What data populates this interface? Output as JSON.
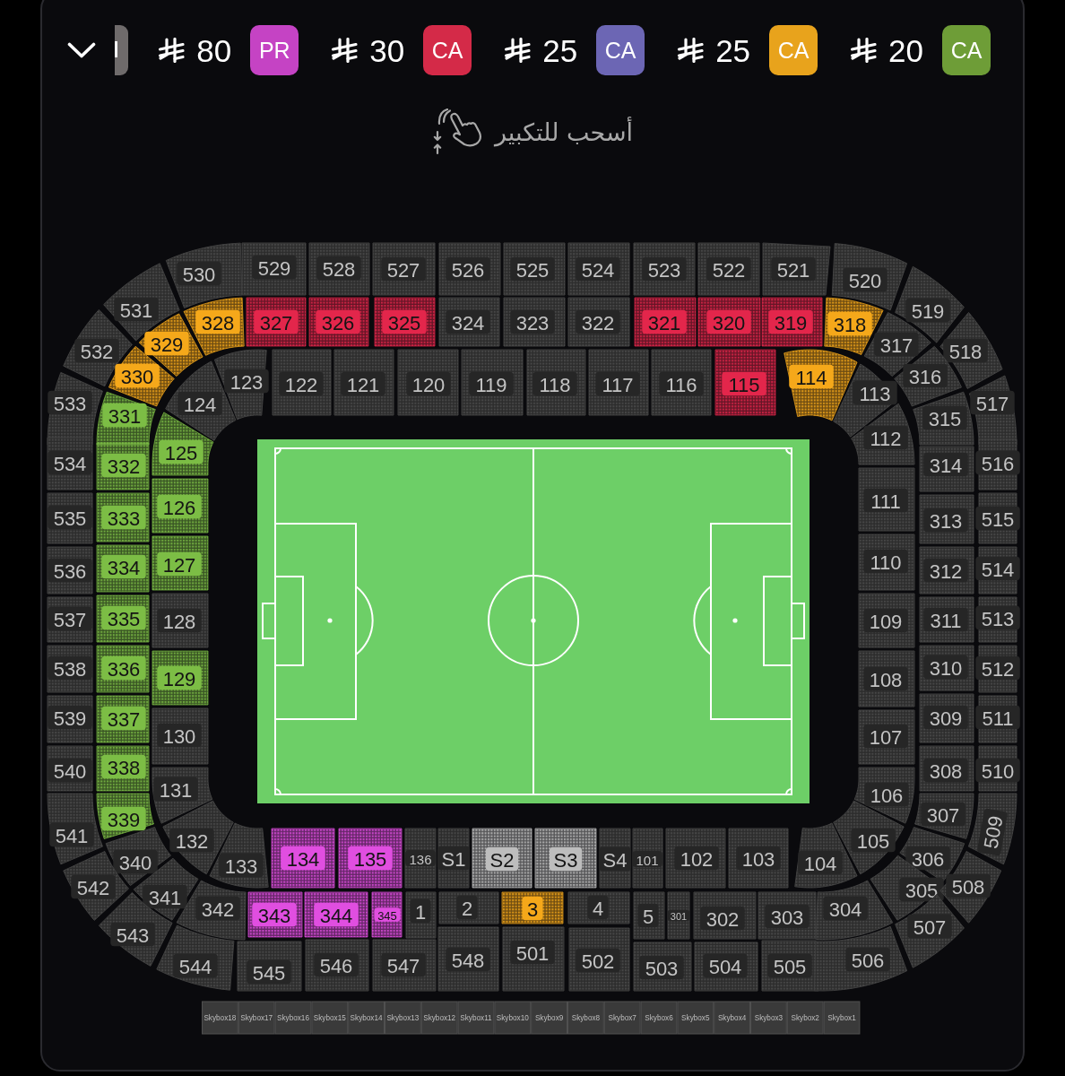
{
  "top_bar": {
    "price_tags": [
      {
        "kind": "clipped",
        "color": "#6f6b6b"
      },
      {
        "kind": "price",
        "price": "80",
        "badge": "PR",
        "color": "#c543c4"
      },
      {
        "kind": "price",
        "price": "30",
        "badge": "CA",
        "color": "#d42a48"
      },
      {
        "kind": "price",
        "price": "25",
        "badge": "CA",
        "color": "#6c66b4"
      },
      {
        "kind": "price",
        "price": "25",
        "badge": "CA",
        "color": "#e8a31c"
      },
      {
        "kind": "price",
        "price": "20",
        "badge": "CA",
        "color": "#6e9d37"
      }
    ]
  },
  "hint": {
    "text": "أسحب للتكبير"
  },
  "seat_map": {
    "sections": [
      {
        "label": "530",
        "available": false
      },
      {
        "label": "529",
        "available": false
      },
      {
        "label": "528",
        "available": false
      },
      {
        "label": "527",
        "available": false
      },
      {
        "label": "526",
        "available": false
      },
      {
        "label": "525",
        "available": false
      },
      {
        "label": "524",
        "available": false
      },
      {
        "label": "523",
        "available": false
      },
      {
        "label": "522",
        "available": false
      },
      {
        "label": "521",
        "available": false
      },
      {
        "label": "520",
        "available": false
      },
      {
        "label": "531",
        "available": false
      },
      {
        "label": "328",
        "available": true,
        "color": "#f5a81a"
      },
      {
        "label": "327",
        "available": true,
        "color": "#e3264b"
      },
      {
        "label": "326",
        "available": true,
        "color": "#e3264b"
      },
      {
        "label": "325",
        "available": true,
        "color": "#e3264b"
      },
      {
        "label": "324",
        "available": false
      },
      {
        "label": "323",
        "available": false
      },
      {
        "label": "322",
        "available": false
      },
      {
        "label": "321",
        "available": true,
        "color": "#e3264b"
      },
      {
        "label": "320",
        "available": true,
        "color": "#e3264b"
      },
      {
        "label": "319",
        "available": true,
        "color": "#e3264b"
      },
      {
        "label": "318",
        "available": true,
        "color": "#f5a81a"
      },
      {
        "label": "519",
        "available": false
      },
      {
        "label": "532",
        "available": false
      },
      {
        "label": "329",
        "available": true,
        "color": "#f5a81a"
      },
      {
        "label": "330",
        "available": true,
        "color": "#f5a81a"
      },
      {
        "label": "123",
        "available": false
      },
      {
        "label": "122",
        "available": false
      },
      {
        "label": "121",
        "available": false
      },
      {
        "label": "120",
        "available": false
      },
      {
        "label": "119",
        "available": false
      },
      {
        "label": "118",
        "available": false
      },
      {
        "label": "117",
        "available": false
      },
      {
        "label": "116",
        "available": false
      },
      {
        "label": "115",
        "available": true,
        "color": "#e3264b"
      },
      {
        "label": "114",
        "available": true,
        "color": "#f5a81a"
      },
      {
        "label": "317",
        "available": false
      },
      {
        "label": "518",
        "available": false
      },
      {
        "label": "316",
        "available": false
      },
      {
        "label": "113",
        "available": false
      },
      {
        "label": "533",
        "available": false
      },
      {
        "label": "331",
        "available": true,
        "color": "#7cbd45"
      },
      {
        "label": "124",
        "available": false
      },
      {
        "label": "315",
        "available": false
      },
      {
        "label": "517",
        "available": false
      },
      {
        "label": "534",
        "available": false
      },
      {
        "label": "332",
        "available": true,
        "color": "#7cbd45"
      },
      {
        "label": "125",
        "available": true,
        "color": "#7cbd45"
      },
      {
        "label": "112",
        "available": false
      },
      {
        "label": "314",
        "available": false
      },
      {
        "label": "516",
        "available": false
      },
      {
        "label": "535",
        "available": false
      },
      {
        "label": "333",
        "available": true,
        "color": "#7cbd45"
      },
      {
        "label": "126",
        "available": true,
        "color": "#7cbd45"
      },
      {
        "label": "111",
        "available": false
      },
      {
        "label": "313",
        "available": false
      },
      {
        "label": "515",
        "available": false
      },
      {
        "label": "536",
        "available": false
      },
      {
        "label": "334",
        "available": true,
        "color": "#7cbd45"
      },
      {
        "label": "127",
        "available": true,
        "color": "#7cbd45"
      },
      {
        "label": "110",
        "available": false
      },
      {
        "label": "312",
        "available": false
      },
      {
        "label": "514",
        "available": false
      },
      {
        "label": "537",
        "available": false
      },
      {
        "label": "335",
        "available": true,
        "color": "#7cbd45"
      },
      {
        "label": "128",
        "available": false
      },
      {
        "label": "109",
        "available": false
      },
      {
        "label": "311",
        "available": false
      },
      {
        "label": "513",
        "available": false
      },
      {
        "label": "538",
        "available": false
      },
      {
        "label": "336",
        "available": true,
        "color": "#7cbd45"
      },
      {
        "label": "129",
        "available": true,
        "color": "#7cbd45"
      },
      {
        "label": "108",
        "available": false
      },
      {
        "label": "310",
        "available": false
      },
      {
        "label": "512",
        "available": false
      },
      {
        "label": "539",
        "available": false
      },
      {
        "label": "337",
        "available": true,
        "color": "#7cbd45"
      },
      {
        "label": "130",
        "available": false
      },
      {
        "label": "107",
        "available": false
      },
      {
        "label": "309",
        "available": false
      },
      {
        "label": "511",
        "available": false
      },
      {
        "label": "540",
        "available": false
      },
      {
        "label": "338",
        "available": true,
        "color": "#7cbd45"
      },
      {
        "label": "131",
        "available": false
      },
      {
        "label": "106",
        "available": false
      },
      {
        "label": "308",
        "available": false
      },
      {
        "label": "510",
        "available": false
      },
      {
        "label": "541",
        "available": false
      },
      {
        "label": "339",
        "available": true,
        "color": "#7cbd45"
      },
      {
        "label": "132",
        "available": false
      },
      {
        "label": "105",
        "available": false
      },
      {
        "label": "307",
        "available": false
      },
      {
        "label": "509",
        "available": false
      },
      {
        "label": "340",
        "available": false
      },
      {
        "label": "133",
        "available": false
      },
      {
        "label": "134",
        "available": true,
        "color": "#e04ee0"
      },
      {
        "label": "135",
        "available": true,
        "color": "#e04ee0"
      },
      {
        "label": "136",
        "available": false
      },
      {
        "label": "S1",
        "available": false
      },
      {
        "label": "S2",
        "available": true,
        "color": "#bdbdbd"
      },
      {
        "label": "S3",
        "available": true,
        "color": "#bdbdbd"
      },
      {
        "label": "S4",
        "available": false
      },
      {
        "label": "101",
        "available": false
      },
      {
        "label": "102",
        "available": false
      },
      {
        "label": "103",
        "available": false
      },
      {
        "label": "104",
        "available": false
      },
      {
        "label": "306",
        "available": false
      },
      {
        "label": "542",
        "available": false
      },
      {
        "label": "341",
        "available": false
      },
      {
        "label": "342",
        "available": false
      },
      {
        "label": "343",
        "available": true,
        "color": "#e04ee0"
      },
      {
        "label": "344",
        "available": true,
        "color": "#e04ee0"
      },
      {
        "label": "345",
        "available": true,
        "color": "#e04ee0"
      },
      {
        "label": "1",
        "available": false
      },
      {
        "label": "2",
        "available": false
      },
      {
        "label": "3",
        "available": true,
        "color": "#f5a81a"
      },
      {
        "label": "4",
        "available": false
      },
      {
        "label": "5",
        "available": false
      },
      {
        "label": "301",
        "available": false
      },
      {
        "label": "302",
        "available": false
      },
      {
        "label": "303",
        "available": false
      },
      {
        "label": "304",
        "available": false
      },
      {
        "label": "305",
        "available": false
      },
      {
        "label": "508",
        "available": false
      },
      {
        "label": "543",
        "available": false
      },
      {
        "label": "544",
        "available": false
      },
      {
        "label": "545",
        "available": false
      },
      {
        "label": "546",
        "available": false
      },
      {
        "label": "547",
        "available": false
      },
      {
        "label": "548",
        "available": false
      },
      {
        "label": "501",
        "available": false
      },
      {
        "label": "502",
        "available": false
      },
      {
        "label": "503",
        "available": false
      },
      {
        "label": "504",
        "available": false
      },
      {
        "label": "505",
        "available": false
      },
      {
        "label": "506",
        "available": false
      },
      {
        "label": "507",
        "available": false
      }
    ],
    "skyboxes": [
      {
        "label": "Skybox18",
        "available": false
      },
      {
        "label": "Skybox17",
        "available": false
      },
      {
        "label": "Skybox16",
        "available": false
      },
      {
        "label": "Skybox15",
        "available": false
      },
      {
        "label": "Skybox14",
        "available": false
      },
      {
        "label": "Skybox13",
        "available": false
      },
      {
        "label": "Skybox12",
        "available": false
      },
      {
        "label": "Skybox11",
        "available": false
      },
      {
        "label": "Skybox10",
        "available": false
      },
      {
        "label": "Skybox9",
        "available": false
      },
      {
        "label": "Skybox8",
        "available": false
      },
      {
        "label": "Skybox7",
        "available": false
      },
      {
        "label": "Skybox6",
        "available": false
      },
      {
        "label": "Skybox5",
        "available": false
      },
      {
        "label": "Skybox4",
        "available": false
      },
      {
        "label": "Skybox3",
        "available": false
      },
      {
        "label": "Skybox2",
        "available": false
      },
      {
        "label": "Skybox1",
        "available": false
      }
    ]
  }
}
